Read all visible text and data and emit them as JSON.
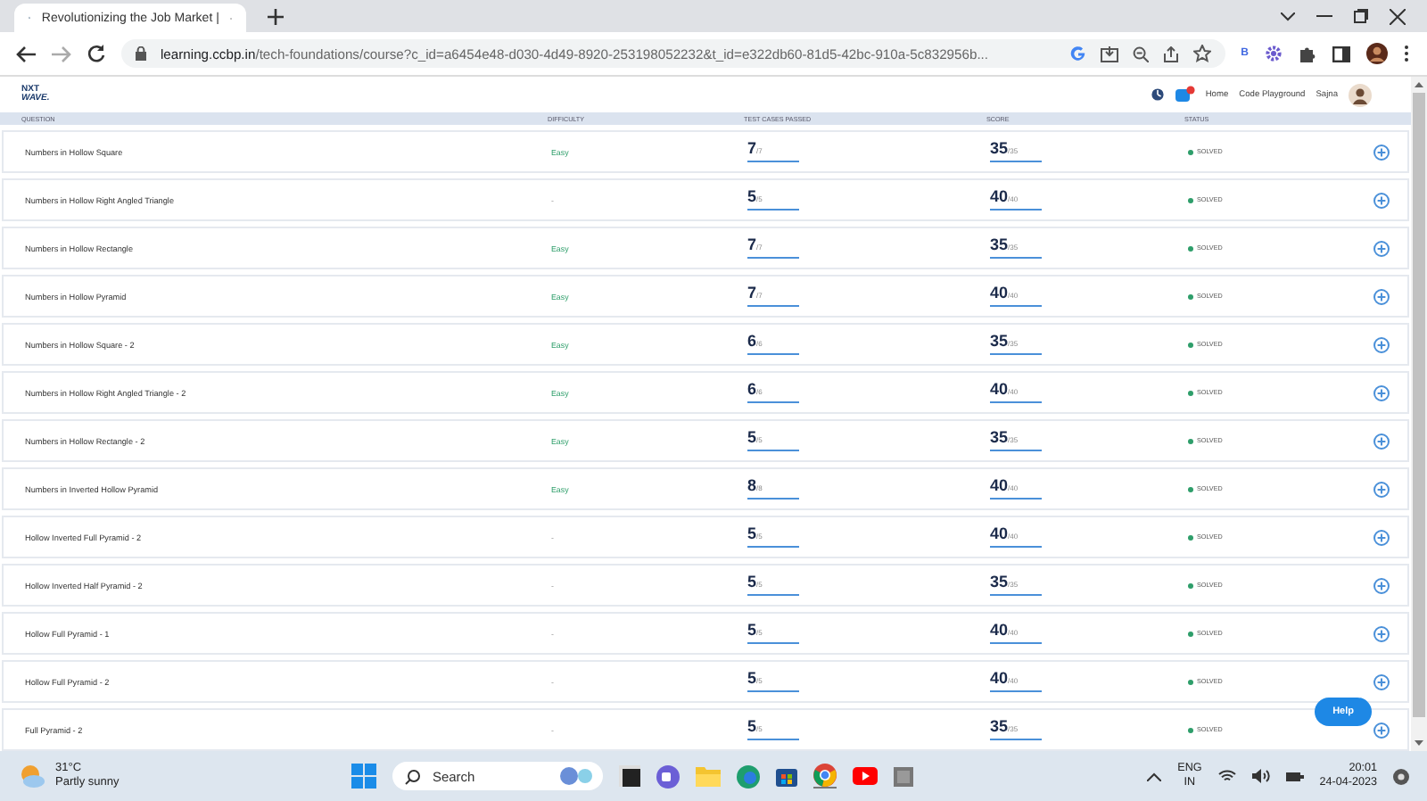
{
  "browser": {
    "tab_title": "Revolutionizing the Job Market |",
    "url_host": "learning.ccbp.in",
    "url_path": "/tech-foundations/course?c_id=a6454e48-d030-4d49-8920-253198052232&t_id=e322db60-81d5-42bc-910a-5c832956b...",
    "extension_letter": "B"
  },
  "header": {
    "logo_top": "NXT",
    "logo_bottom": "WAVE.",
    "nav": [
      "Home",
      "Code Playground"
    ],
    "user_name": "Sajna"
  },
  "table": {
    "columns": [
      "QUESTION",
      "DIFFICULTY",
      "TEST CASES PASSED",
      "SCORE",
      "STATUS"
    ],
    "rows": [
      {
        "question": "Numbers in Hollow Square",
        "difficulty": "Easy",
        "tests": {
          "passed": "7",
          "total": "/7",
          "level": 1
        },
        "score": {
          "value": "35",
          "max": "/35",
          "level": 1
        },
        "status": "SOLVED"
      },
      {
        "question": "Numbers in Hollow Right Angled Triangle",
        "difficulty": "-",
        "tests": {
          "passed": "5",
          "total": "/5",
          "level": 1
        },
        "score": {
          "value": "40",
          "max": "/40",
          "level": 1
        },
        "status": "SOLVED"
      },
      {
        "question": "Numbers in Hollow Rectangle",
        "difficulty": "Easy",
        "tests": {
          "passed": "7",
          "total": "/7",
          "level": 1
        },
        "score": {
          "value": "35",
          "max": "/35",
          "level": 1
        },
        "status": "SOLVED"
      },
      {
        "question": "Numbers in Hollow Pyramid",
        "difficulty": "Easy",
        "tests": {
          "passed": "7",
          "total": "/7",
          "level": 1
        },
        "score": {
          "value": "40",
          "max": "/40",
          "level": 1
        },
        "status": "SOLVED"
      },
      {
        "question": "Numbers in Hollow Square - 2",
        "difficulty": "Easy",
        "tests": {
          "passed": "6",
          "total": "/6",
          "level": 1
        },
        "score": {
          "value": "35",
          "max": "/35",
          "level": 1
        },
        "status": "SOLVED"
      },
      {
        "question": "Numbers in Hollow Right Angled Triangle - 2",
        "difficulty": "Easy",
        "tests": {
          "passed": "6",
          "total": "/6",
          "level": 1
        },
        "score": {
          "value": "40",
          "max": "/40",
          "level": 1
        },
        "status": "SOLVED"
      },
      {
        "question": "Numbers in Hollow Rectangle - 2",
        "difficulty": "Easy",
        "tests": {
          "passed": "5",
          "total": "/5",
          "level": 1
        },
        "score": {
          "value": "35",
          "max": "/35",
          "level": 1
        },
        "status": "SOLVED"
      },
      {
        "question": "Numbers in Inverted Hollow Pyramid",
        "difficulty": "Easy",
        "tests": {
          "passed": "8",
          "total": "/8",
          "level": 1
        },
        "score": {
          "value": "40",
          "max": "/40",
          "level": 1
        },
        "status": "SOLVED"
      },
      {
        "question": "Hollow Inverted Full Pyramid - 2",
        "difficulty": "-",
        "tests": {
          "passed": "5",
          "total": "/5",
          "level": 1
        },
        "score": {
          "value": "40",
          "max": "/40",
          "level": 1
        },
        "status": "SOLVED"
      },
      {
        "question": "Hollow Inverted Half Pyramid - 2",
        "difficulty": "-",
        "tests": {
          "passed": "5",
          "total": "/5",
          "level": 1
        },
        "score": {
          "value": "35",
          "max": "/35",
          "level": 1
        },
        "status": "SOLVED"
      },
      {
        "question": "Hollow Full Pyramid - 1",
        "difficulty": "-",
        "tests": {
          "passed": "5",
          "total": "/5",
          "level": 1
        },
        "score": {
          "value": "40",
          "max": "/40",
          "level": 1
        },
        "status": "SOLVED"
      },
      {
        "question": "Hollow Full Pyramid - 2",
        "difficulty": "-",
        "tests": {
          "passed": "5",
          "total": "/5",
          "level": 1
        },
        "score": {
          "value": "40",
          "max": "/40",
          "level": 1
        },
        "status": "SOLVED"
      },
      {
        "question": "Full Pyramid - 2",
        "difficulty": "-",
        "tests": {
          "passed": "5",
          "total": "/5",
          "level": 1
        },
        "score": {
          "value": "35",
          "max": "/35",
          "level": 1
        },
        "status": "SOLVED"
      }
    ]
  },
  "help_button": "Help",
  "taskbar": {
    "temperature": "31°C",
    "weather": "Partly sunny",
    "search": "Search",
    "language": "ENG",
    "region": "IN",
    "time": "20:01",
    "date": "24-04-2023"
  }
}
